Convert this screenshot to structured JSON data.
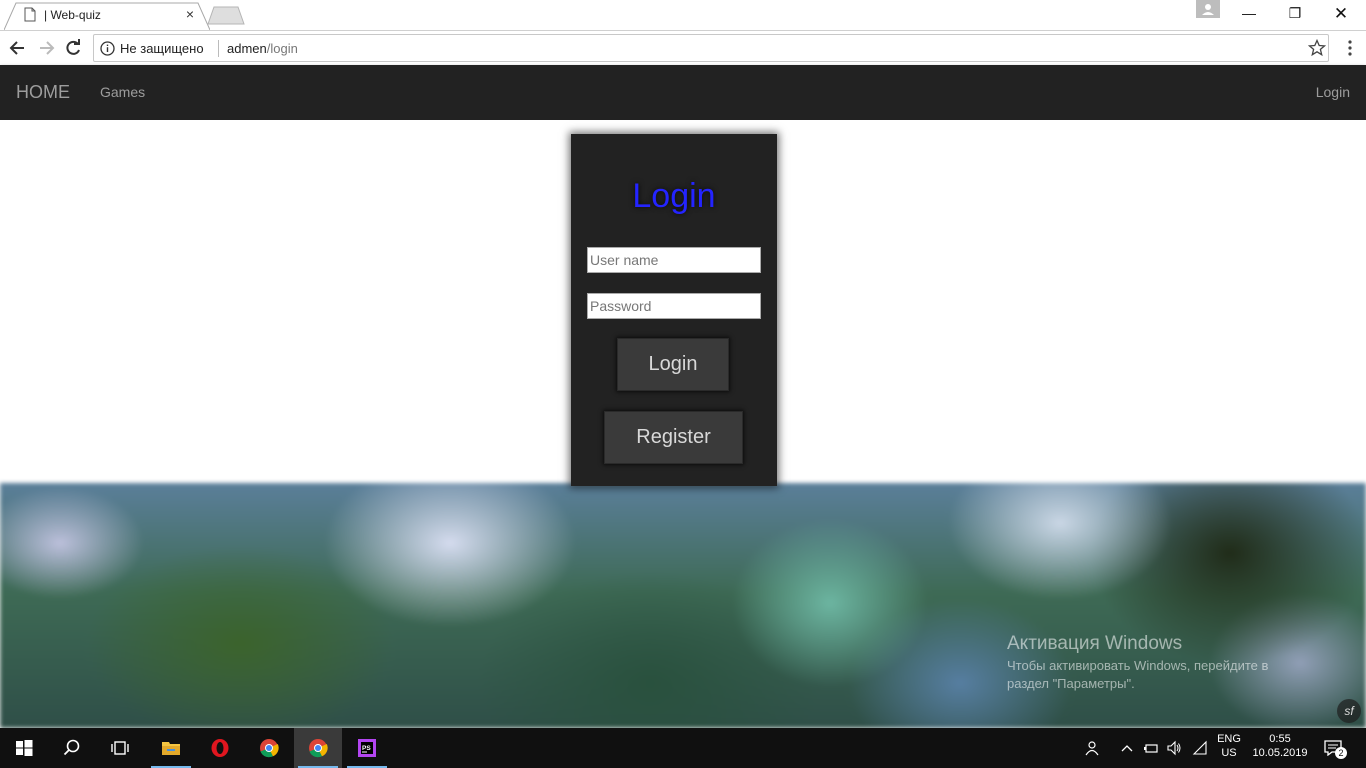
{
  "browser": {
    "tab_title": "| Web-quiz",
    "tab_close": "×",
    "security_label": "Не защищено",
    "url_host": "admen",
    "url_path": "/login",
    "window_controls": {
      "minimize": "—",
      "restore": "❐",
      "close": "✕"
    }
  },
  "navbar": {
    "home": "HOME",
    "games": "Games",
    "login": "Login"
  },
  "login_form": {
    "title": "Login",
    "username_placeholder": "User name",
    "password_placeholder": "Password",
    "username_value": "",
    "password_value": "",
    "login_button": "Login",
    "register_button": "Register",
    "title_color": "#2424ff",
    "panel_color": "#222222"
  },
  "watermark": {
    "title": "Активация Windows",
    "line1": "Чтобы активировать Windows, перейдите в",
    "line2": "раздел \"Параметры\"."
  },
  "taskbar": {
    "apps": [
      "windows-start-icon",
      "search-icon",
      "task-view-icon",
      "file-explorer-icon",
      "opera-icon",
      "chrome-icon",
      "chrome-icon",
      "phpstorm-icon"
    ],
    "language": "ENG",
    "layout": "US",
    "time": "0:55",
    "date": "10.05.2019",
    "notification_count": "2"
  }
}
